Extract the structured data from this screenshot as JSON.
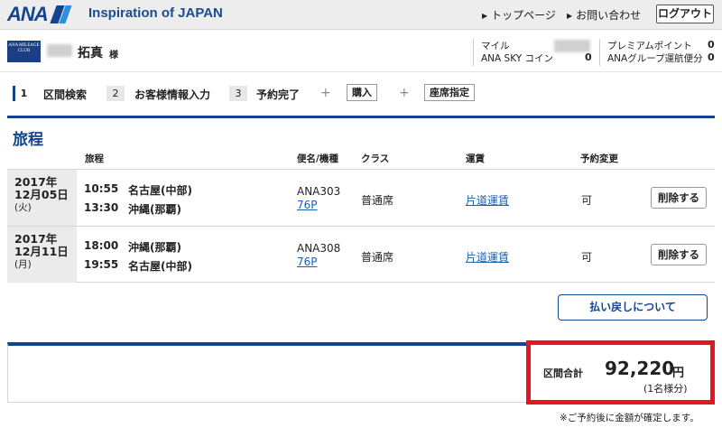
{
  "header": {
    "logo_text": "ANA",
    "tagline": "Inspiration of JAPAN",
    "links": [
      "トップページ",
      "お問い合わせ"
    ],
    "logout": "ログアウト"
  },
  "member": {
    "card_logo": "ANA MILEAGE CLUB",
    "name": "拓真",
    "honorific": "様",
    "mile_label": "マイル",
    "coin_label": "ANA SKY コイン",
    "mile_value": "",
    "coin_value": "0",
    "premium_label": "プレミアムポイント",
    "premium_value": "0",
    "group_label": "ANAグループ運航便分",
    "group_value": "0"
  },
  "steps": {
    "items": [
      {
        "num": "1",
        "label": "区間検索"
      },
      {
        "num": "2",
        "label": "お客様情報入力"
      },
      {
        "num": "3",
        "label": "予約完了"
      }
    ],
    "extra1": "購入",
    "extra2": "座席指定",
    "plus": "+"
  },
  "itinerary": {
    "title": "旅程",
    "headers": {
      "route": "旅程",
      "flight": "便名/機種",
      "class": "クラス",
      "fare": "運賃",
      "change": "予約変更"
    },
    "rows": [
      {
        "year": "2017年",
        "date": "12月05日",
        "dow": "(火)",
        "dep_time": "10:55",
        "dep_place": "名古屋(中部)",
        "arr_time": "13:30",
        "arr_place": "沖縄(那覇)",
        "flight": "ANA303",
        "aircraft": "76P",
        "class": "普通席",
        "fare": "片道運賃",
        "change": "可",
        "delete": "削除する"
      },
      {
        "year": "2017年",
        "date": "12月11日",
        "dow": "(月)",
        "dep_time": "18:00",
        "dep_place": "沖縄(那覇)",
        "arr_time": "19:55",
        "arr_place": "名古屋(中部)",
        "flight": "ANA308",
        "aircraft": "76P",
        "class": "普通席",
        "fare": "片道運賃",
        "change": "可",
        "delete": "削除する"
      }
    ],
    "refund_button": "払い戻しについて"
  },
  "total": {
    "label": "区間合計",
    "amount": "92,220",
    "currency": "円",
    "per": "(1名様分)",
    "note": "※ご予約後に金額が確定します。"
  },
  "colors": {
    "brand": "#13448f",
    "link": "#1a5fb4",
    "highlight": "#e8141e"
  }
}
